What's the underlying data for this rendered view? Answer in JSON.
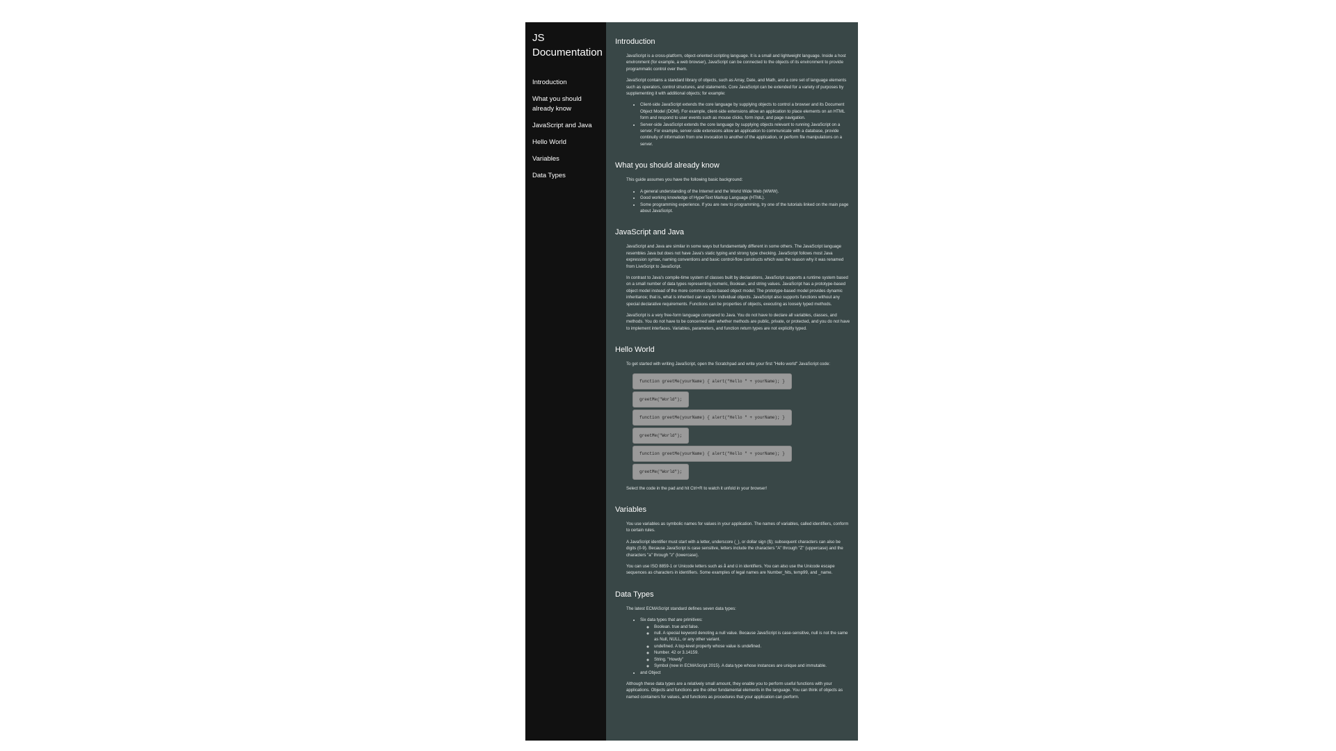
{
  "sidebar": {
    "title_line1": "JS",
    "title_line2": "Documentation",
    "nav": [
      {
        "label": "Introduction"
      },
      {
        "label_line1": "What you should",
        "label_line2": "already know"
      },
      {
        "label": "JavaScript and Java"
      },
      {
        "label": "Hello World"
      },
      {
        "label": "Variables"
      },
      {
        "label": "Data Types"
      }
    ]
  },
  "sections": {
    "introduction": {
      "heading": "Introduction",
      "p1": "JavaScript is a cross-platform, object-oriented scripting language. It is a small and lightweight language. Inside a host environment (for example, a web browser), JavaScript can be connected to the objects of its environment to provide programmatic control over them.",
      "p2": "JavaScript contains a standard library of objects, such as Array, Date, and Math, and a core set of language elements such as operators, control structures, and statements. Core JavaScript can be extended for a variety of purposes by supplementing it with additional objects; for example:",
      "items": [
        "Client-side JavaScript extends the core language by supplying objects to control a browser and its Document Object Model (DOM). For example, client-side extensions allow an application to place elements on an HTML form and respond to user events such as mouse clicks, form input, and page navigation.",
        "Server-side JavaScript extends the core language by supplying objects relevant to running JavaScript on a server. For example, server-side extensions allow an application to communicate with a database, provide continuity of information from one invocation to another of the application, or perform file manipulations on a server."
      ]
    },
    "already_know": {
      "heading": "What you should already know",
      "p1": "This guide assumes you have the following basic background:",
      "items": [
        "A general understanding of the Internet and the World Wide Web (WWW).",
        "Good working knowledge of HyperText Markup Language (HTML).",
        "Some programming experience. If you are new to programming, try one of the tutorials linked on the main page about JavaScript."
      ]
    },
    "js_java": {
      "heading": "JavaScript and Java",
      "p1": "JavaScript and Java are similar in some ways but fundamentally different in some others. The JavaScript language resembles Java but does not have Java's static typing and strong type checking. JavaScript follows most Java expression syntax, naming conventions and basic control-flow constructs which was the reason why it was renamed from LiveScript to JavaScript.",
      "p2": "In contrast to Java's compile-time system of classes built by declarations, JavaScript supports a runtime system based on a small number of data types representing numeric, Boolean, and string values. JavaScript has a prototype-based object model instead of the more common class-based object model. The prototype-based model provides dynamic inheritance; that is, what is inherited can vary for individual objects. JavaScript also supports functions without any special declarative requirements. Functions can be properties of objects, executing as loosely typed methods.",
      "p3": "JavaScript is a very free-form language compared to Java. You do not have to declare all variables, classes, and methods. You do not have to be concerned with whether methods are public, private, or protected, and you do not have to implement interfaces. Variables, parameters, and function return types are not explicitly typed."
    },
    "hello_world": {
      "heading": "Hello World",
      "p1": "To get started with writing JavaScript, open the Scratchpad and write your first \"Hello world\" JavaScript code:",
      "code": [
        "function greetMe(yourName) { alert(\"Hello \" + yourName); }",
        "greetMe(\"World\");",
        "function greetMe(yourName) { alert(\"Hello \" + yourName); }",
        "greetMe(\"World\");",
        "function greetMe(yourName) { alert(\"Hello \" + yourName); }",
        "greetMe(\"World\");"
      ],
      "p2": "Select the code in the pad and hit Ctrl+R to watch it unfold in your browser!"
    },
    "variables": {
      "heading": "Variables",
      "p1": "You use variables as symbolic names for values in your application. The names of variables, called identifiers, conform to certain rules.",
      "p2": "A JavaScript identifier must start with a letter, underscore (_), or dollar sign ($); subsequent characters can also be digits (0-9). Because JavaScript is case sensitive, letters include the characters \"A\" through \"Z\" (uppercase) and the characters \"a\" through \"z\" (lowercase).",
      "p3": "You can use ISO 8859-1 or Unicode letters such as å and ü in identifiers. You can also use the Unicode escape sequences as characters in identifiers. Some examples of legal names are Number_hits, temp99, and _name."
    },
    "data_types": {
      "heading": "Data Types",
      "p1": "The latest ECMAScript standard defines seven data types:",
      "primitives_label": "Six data types that are primitives:",
      "primitives": [
        "Boolean. true and false.",
        "null. A special keyword denoting a null value. Because JavaScript is case-sensitive, null is not the same as Null, NULL, or any other variant.",
        "undefined. A top-level property whose value is undefined.",
        "Number. 42 or 3.14159.",
        "String. \"Howdy\"",
        "Symbol (new in ECMAScript 2015). A data type whose instances are unique and immutable."
      ],
      "object_label": "and Object",
      "p2": "Although these data types are a relatively small amount, they enable you to perform useful functions with your applications. Objects and functions are the other fundamental elements in the language. You can think of objects as named containers for values, and functions as procedures that your application can perform."
    }
  }
}
